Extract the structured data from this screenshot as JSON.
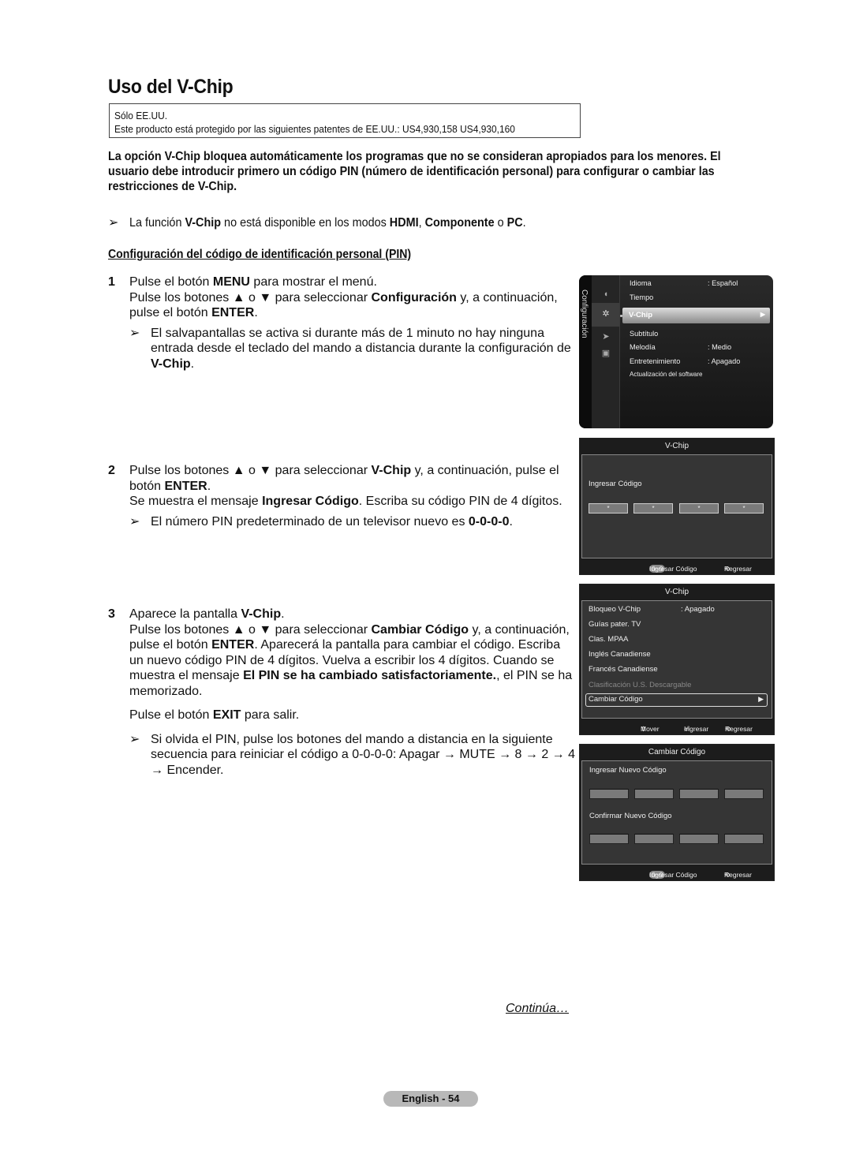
{
  "title": "Uso del V-Chip",
  "notice": {
    "line1": "Sólo EE.UU.",
    "line2": "Este producto está protegido por las siguientes patentes de EE.UU.: US4,930,158 US4,930,160"
  },
  "intro": [
    "La opción V-Chip bloquea automáticamente los programas que no se consideran apropiados para los menores. El",
    "usuario debe introducir primero un código PIN (número de identificación personal) para configurar o cambiar las",
    "restricciones de V-Chip."
  ],
  "note_modes": {
    "arrow": "➢",
    "t1": "La función ",
    "b1": "V-Chip",
    "t2": " no está disponible en los modos ",
    "b2": "HDMI",
    "t3": ", ",
    "b3": "Componente",
    "t4": " o ",
    "b4": "PC",
    "t5": "."
  },
  "subheading": "Configuración del código de identificación personal (PIN)",
  "steps": [
    {
      "num": "1",
      "l1a": "Pulse el botón ",
      "l1b": "MENU",
      "l1c": " para mostrar el menú.",
      "l2a": "Pulse los botones ▲ o ▼ para seleccionar ",
      "l2b": "Configuración",
      "l2c": " y,  a continuación,",
      "l3a": "pulse el botón ",
      "l3b": "ENTER",
      "l3c": ".",
      "note_arrow": "➢",
      "n1": "El salvapantallas se activa si durante más de 1 minuto no hay ninguna",
      "n2": "entrada desde el teclado del mando a distancia durante la configuración de",
      "n3b": "V-Chip",
      "n3c": "."
    },
    {
      "num": "2",
      "l1a": "Pulse los botones ▲ o ▼ para seleccionar ",
      "l1b": "V-Chip",
      "l1c": " y, a continuación, pulse el",
      "l2a": "botón ",
      "l2b": "ENTER",
      "l2c": ".",
      "l3a": "Se muestra el mensaje ",
      "l3b": "Ingresar Código",
      "l3c": ". Escriba su código PIN de 4 dígitos.",
      "note_arrow": "➢",
      "n1a": "El número PIN predeterminado de un televisor nuevo es ",
      "n1b": "0-0-0-0",
      "n1c": "."
    },
    {
      "num": "3",
      "l1a": "Aparece la pantalla ",
      "l1b": "V-Chip",
      "l1c": ".",
      "l2a": "Pulse los botones ▲ o ▼ para seleccionar ",
      "l2b": "Cambiar Código",
      "l2c": " y, a continuación,",
      "l3a": "pulse el botón ",
      "l3b": "ENTER",
      "l3c": ". Aparecerá la pantalla para cambiar el código. Escriba",
      "l4": "un nuevo código PIN de 4 dígitos. Vuelva a escribir los 4 dígitos. Cuando se",
      "l5a": "muestra el mensaje ",
      "l5b": "El PIN se ha cambiado satisfactoriamente.",
      "l5c": ", el PIN se ha",
      "l6": "memorizado.",
      "l7a": "Pulse el botón ",
      "l7b": "EXIT",
      "l7c": " para salir.",
      "note_arrow": "➢",
      "n1": "Si olvida el PIN, pulse los botones del mando a distancia en la siguiente",
      "n2": "secuencia para reiniciar el código a 0-0-0-0: Apagar → MUTE → 8 → 2 → 4",
      "n3": "→ Encender."
    }
  ],
  "continua": "Continúa…",
  "page_label": "English - 54",
  "screens": {
    "menu": {
      "side_label": "Configuración",
      "icons": [
        "picture-icon",
        "setup-icon",
        "input-icon",
        "application-icon"
      ],
      "items": [
        {
          "label": "Idioma",
          "value": ": Español"
        },
        {
          "label": "Tiempo",
          "value": ""
        },
        {
          "label": "V-Chip",
          "value": "",
          "selected": true
        },
        {
          "label": "Subtítulo",
          "value": ""
        },
        {
          "label": "Melodía",
          "value": ": Medio"
        },
        {
          "label": "Entretenimiento",
          "value": ": Apagado"
        },
        {
          "label": "Actualización del software",
          "value": ""
        }
      ],
      "selected_arrow": "▶"
    },
    "pin": {
      "title": "V-Chip",
      "prompt": "Ingresar Código",
      "digits": [
        "*",
        "*",
        "*",
        "*"
      ],
      "footer_key": "0~9",
      "footer_enter": "Ingresar Código",
      "footer_back_icon": "⟲",
      "footer_back": "Regresar"
    },
    "vchip": {
      "title": "V-Chip",
      "items": [
        {
          "label": "Bloqueo V-Chip",
          "value": ": Apagado"
        },
        {
          "label": "Guías pater. TV",
          "value": ""
        },
        {
          "label": "Clas. MPAA",
          "value": ""
        },
        {
          "label": "Inglés Canadiense",
          "value": ""
        },
        {
          "label": "Francés Canadiense",
          "value": ""
        },
        {
          "label": "Clasificación U.S. Descargable",
          "value": "",
          "disabled": true
        },
        {
          "label": "Cambiar Código",
          "value": "",
          "selected": true
        }
      ],
      "selected_arrow": "▶",
      "footer_move_icon": "⇕",
      "footer_move": "Mover",
      "footer_enter_icon": "⏎",
      "footer_enter": "Ingresar",
      "footer_back_icon": "⟲",
      "footer_back": "Regresar"
    },
    "change": {
      "title": "Cambiar Código",
      "new_label": "Ingresar Nuevo Código",
      "confirm_label": "Confirmar Nuevo Código",
      "footer_key": "0~9",
      "footer_enter": "Ingresar Código",
      "footer_back_icon": "⟲",
      "footer_back": "Regresar"
    }
  }
}
